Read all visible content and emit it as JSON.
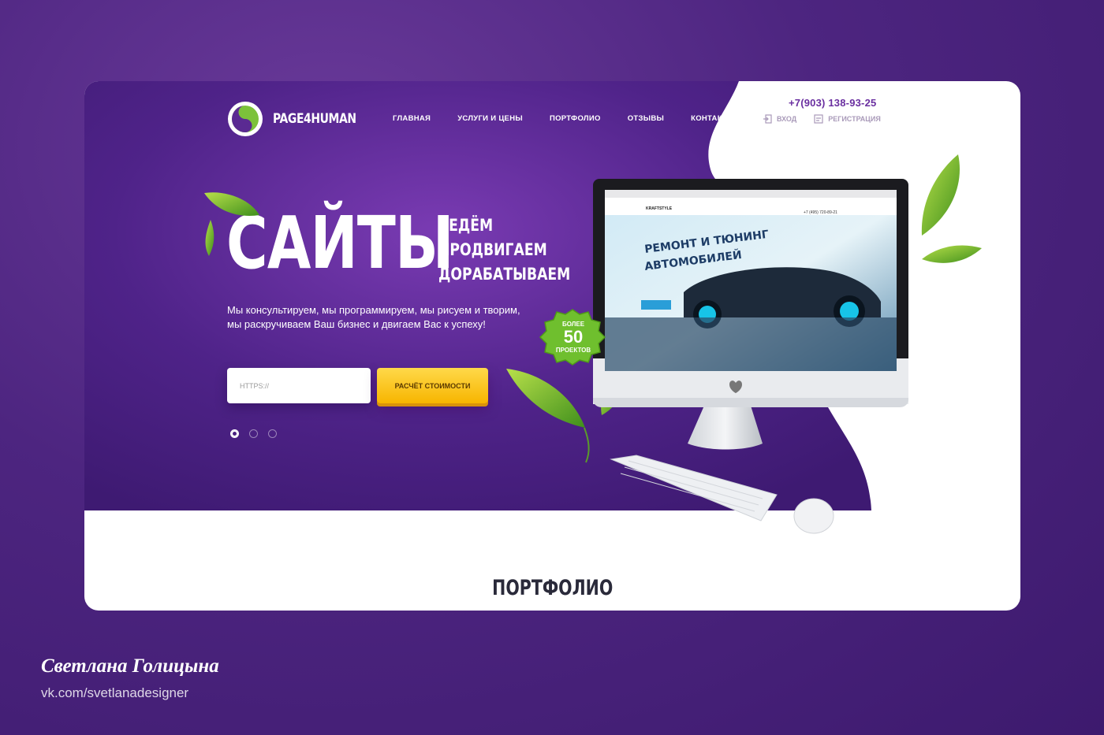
{
  "header": {
    "logo_text": "PAGE4HUMAN",
    "nav": [
      "ГЛАВНАЯ",
      "УСЛУГИ И ЦЕНЫ",
      "ПОРТФОЛИО",
      "ОТЗЫВЫ",
      "КОНТАКТЫ"
    ],
    "phone": "+7(903) 138-93-25",
    "login_label": "ВХОД",
    "register_label": "РЕГИСТРАЦИЯ"
  },
  "hero": {
    "title": "САЙТЫ",
    "sub": [
      "ВЕДЁМ",
      "ПРОДВИГАЕМ",
      "ДОРАБАТЫВАЕМ"
    ],
    "description": "Мы консультируем, мы программируем, мы рисуем и творим, мы раскручиваем Ваш бизнес и двигаем Вас к успеху!",
    "url_placeholder": "HTTPS://",
    "calc_button": "РАСЧЁТ СТОИМОСТИ",
    "slides_total": 3,
    "slide_active": 1,
    "badge": {
      "top": "БОЛЕЕ",
      "number": "50",
      "bottom": "ПРОЕКТОВ"
    }
  },
  "screen": {
    "brand": "KRAFTSTYLE",
    "phone": "+7 (495) 720-89-21",
    "headline_1": "РЕМОНТ И ТЮНИНГ",
    "headline_2": "АВТОМОБИЛЕЙ"
  },
  "section_title": "ПОРТФОЛИО",
  "credits": {
    "author": "Светлана Голицына",
    "link": "vk.com/svetlanadesigner"
  },
  "colors": {
    "purple": "#4d2285",
    "accent_yellow": "#f7b500",
    "green": "#7cc23a"
  }
}
